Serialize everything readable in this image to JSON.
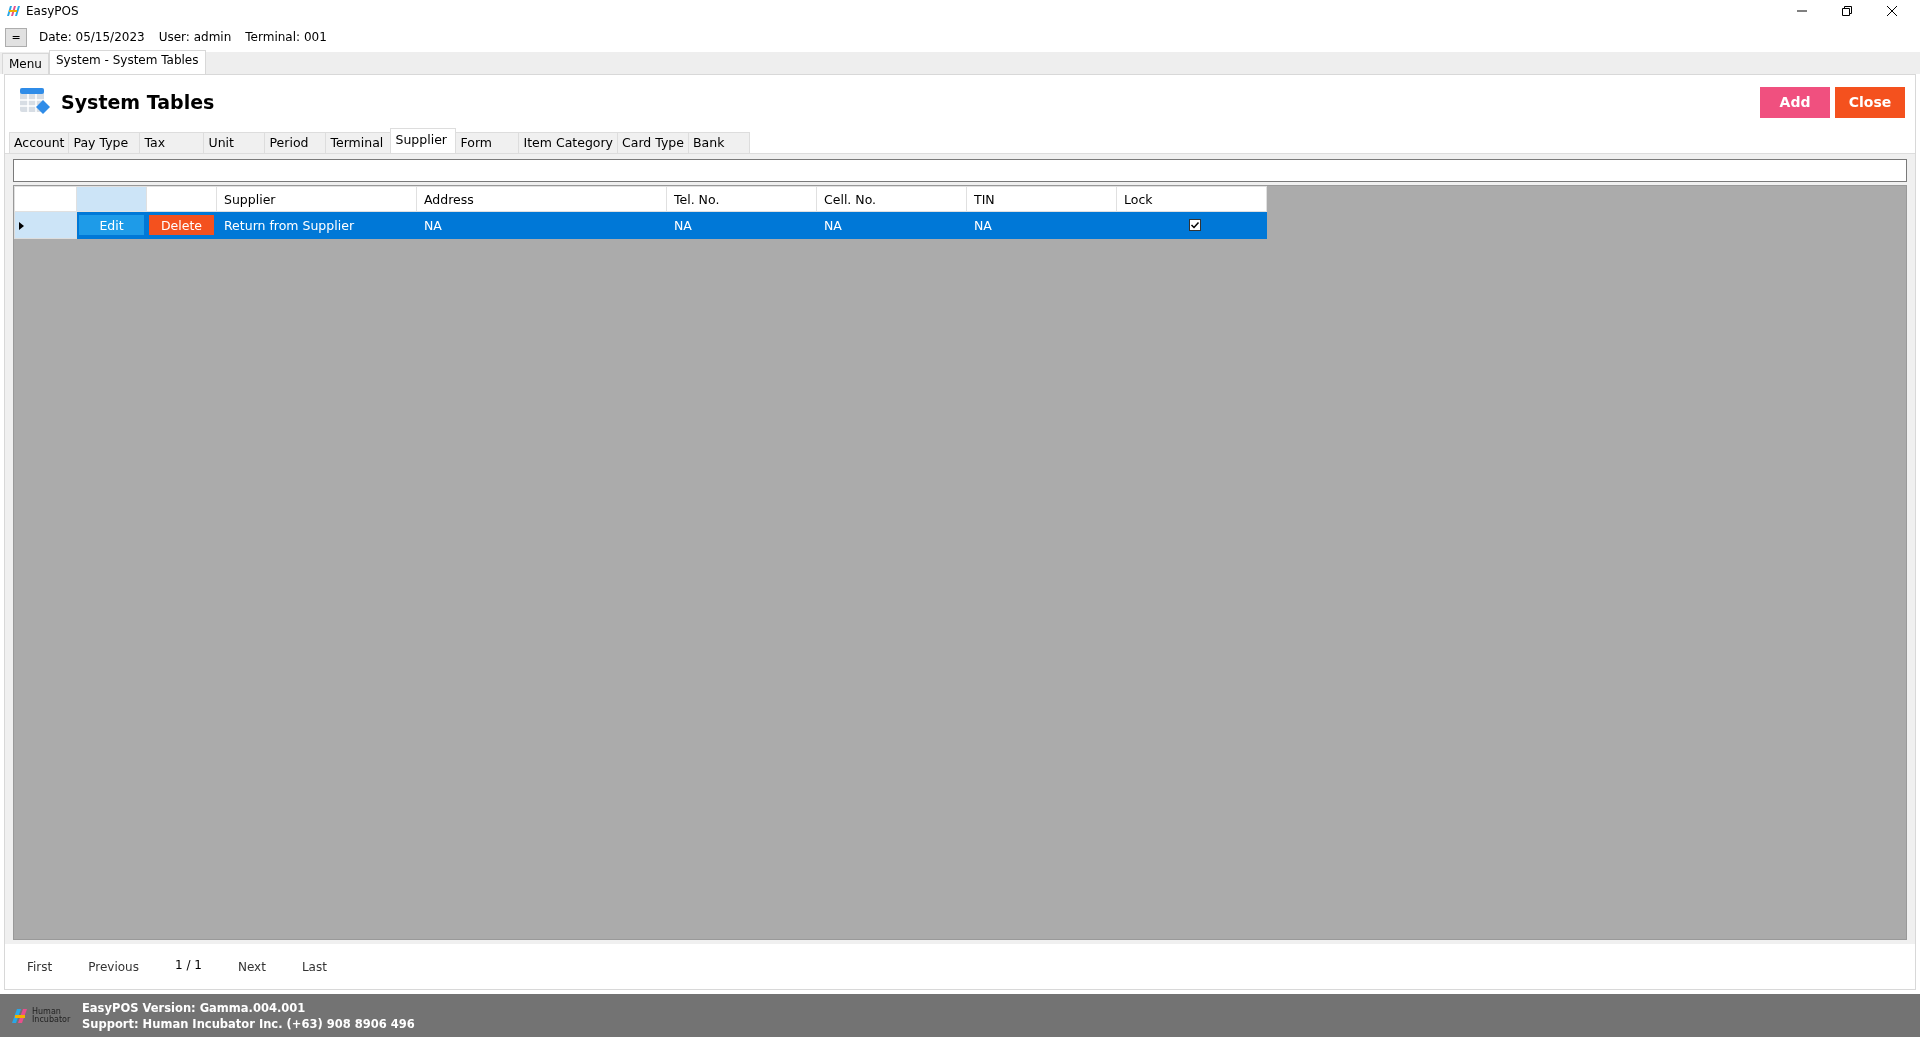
{
  "window": {
    "title": "EasyPOS"
  },
  "info_bar": {
    "menu_button": "=",
    "date": "Date: 05/15/2023",
    "user": "User: admin",
    "terminal": "Terminal: 001"
  },
  "document_tabs": [
    {
      "label": "Menu",
      "selected": false
    },
    {
      "label": "System - System Tables",
      "selected": true
    }
  ],
  "page": {
    "title": "System Tables",
    "buttons": [
      {
        "label": "Add",
        "kind": "add"
      },
      {
        "label": "Close",
        "kind": "close"
      }
    ]
  },
  "tabs": [
    {
      "label": "Account",
      "selected": false
    },
    {
      "label": "Pay Type",
      "selected": false
    },
    {
      "label": "Tax",
      "selected": false
    },
    {
      "label": "Unit",
      "selected": false
    },
    {
      "label": "Period",
      "selected": false
    },
    {
      "label": "Terminal",
      "selected": false
    },
    {
      "label": "Supplier",
      "selected": true
    },
    {
      "label": "Form",
      "selected": false
    },
    {
      "label": "Item Category",
      "selected": false
    },
    {
      "label": "Card Type",
      "selected": false
    },
    {
      "label": "Bank",
      "selected": false
    }
  ],
  "table": {
    "columns": [
      "Supplier",
      "Address",
      "Tel. No.",
      "Cell. No.",
      "TIN",
      "Lock"
    ],
    "rows": [
      {
        "selected": true,
        "edit": "Edit",
        "delete": "Delete",
        "cells": [
          "Return from Supplier",
          "NA",
          "NA",
          "NA",
          "NA"
        ],
        "lock": true
      }
    ]
  },
  "pager": {
    "first": "First",
    "previous": "Previous",
    "page": "1 / 1",
    "next": "Next",
    "last": "Last"
  },
  "status_bar": {
    "logo_text": "Human Incubator",
    "version": "EasyPOS Version: Gamma.004.001",
    "support": "Support: Human Incubator Inc. (+63) 908 8906 496"
  }
}
